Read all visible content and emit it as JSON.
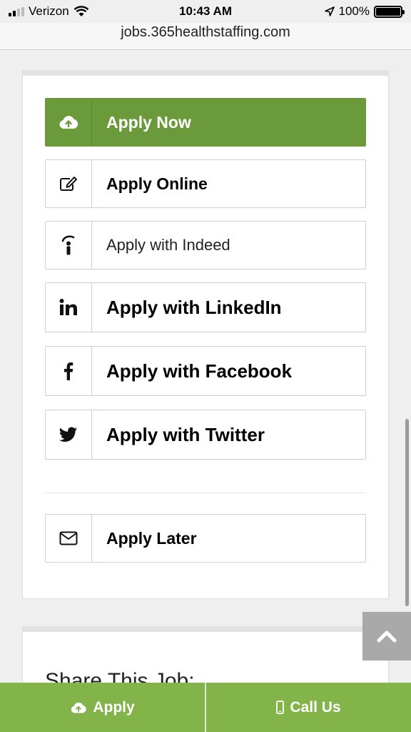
{
  "status": {
    "carrier": "Verizon",
    "time": "10:43 AM",
    "battery": "100%"
  },
  "browser": {
    "url": "jobs.365healthstaffing.com"
  },
  "apply": {
    "now": "Apply Now",
    "online": "Apply Online",
    "indeed": "Apply with Indeed",
    "linkedin": "Apply with LinkedIn",
    "facebook": "Apply with Facebook",
    "twitter": "Apply with Twitter",
    "later": "Apply Later"
  },
  "share": {
    "title": "Share This Job:"
  },
  "bottom_bar": {
    "apply_label": "Apply",
    "call_label": "Call Us"
  },
  "colors": {
    "primary_green": "#6a9a3a",
    "bar_green": "#82b44a"
  }
}
